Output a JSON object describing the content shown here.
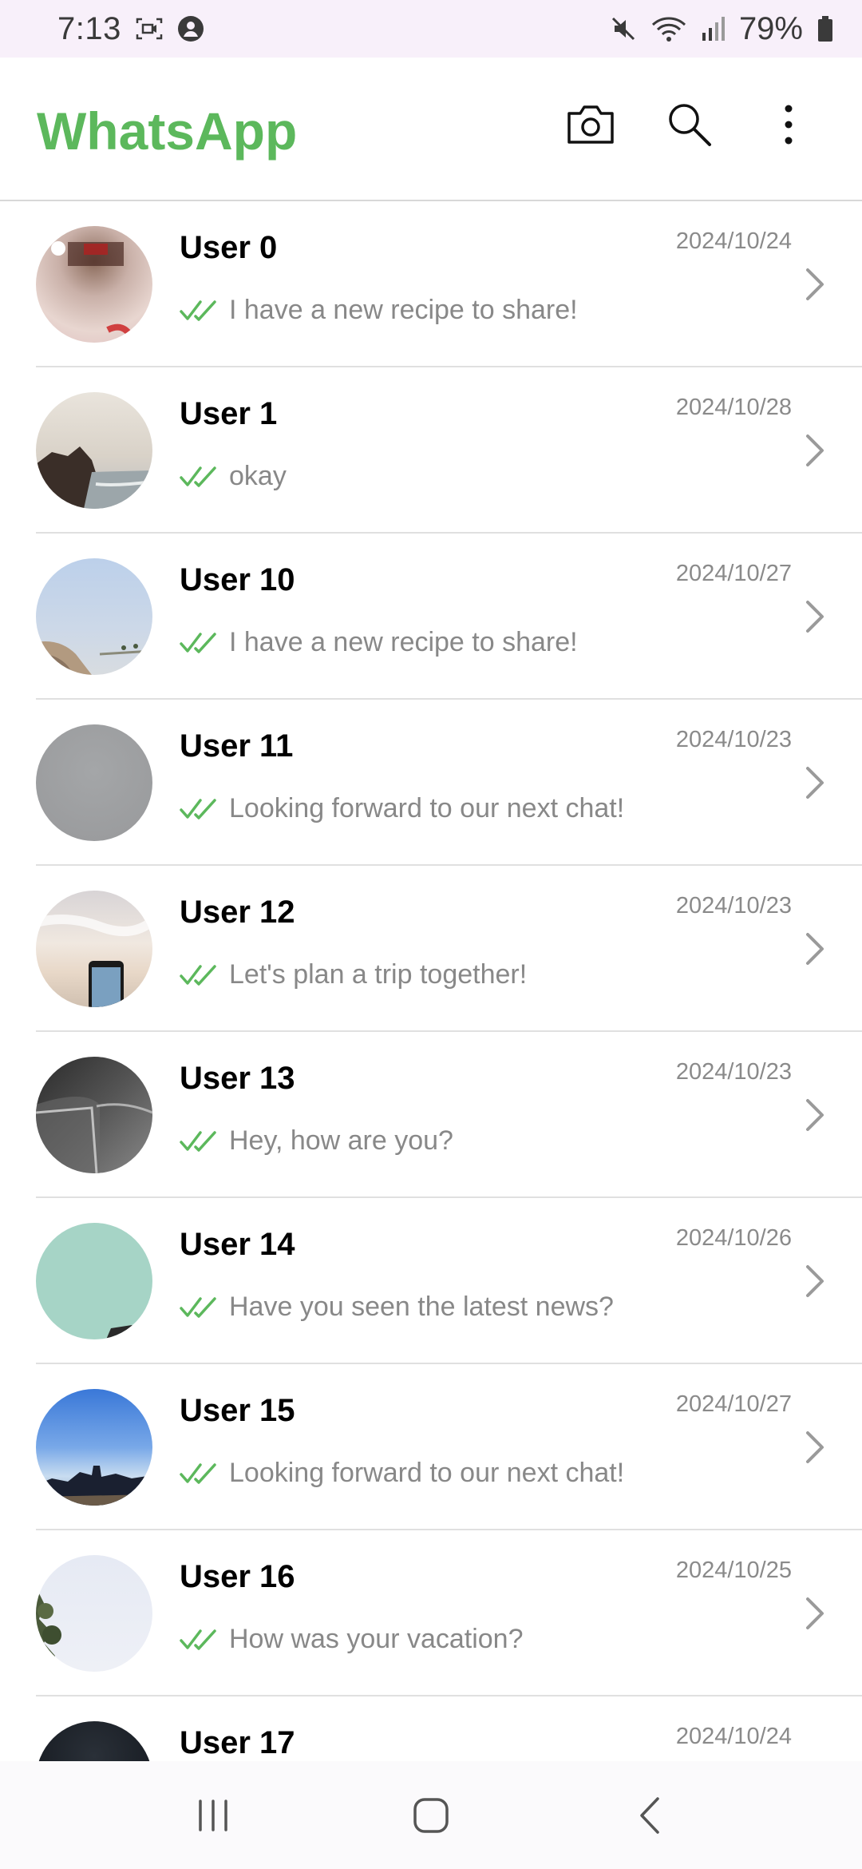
{
  "status_bar": {
    "time": "7:13",
    "battery": "79%"
  },
  "app": {
    "title": "WhatsApp",
    "accent_color": "#5cb85c"
  },
  "actions": {
    "camera_icon": "camera-icon",
    "search_icon": "search-icon",
    "menu_icon": "more-vert-icon"
  },
  "chats": [
    {
      "name": "User 0",
      "date": "2024/10/24",
      "message": "I have a new recipe to share!"
    },
    {
      "name": "User 1",
      "date": "2024/10/28",
      "message": "okay"
    },
    {
      "name": "User 10",
      "date": "2024/10/27",
      "message": "I have a new recipe to share!"
    },
    {
      "name": "User 11",
      "date": "2024/10/23",
      "message": "Looking forward to our next chat!"
    },
    {
      "name": "User 12",
      "date": "2024/10/23",
      "message": "Let's plan a trip together!"
    },
    {
      "name": "User 13",
      "date": "2024/10/23",
      "message": "Hey, how are you?"
    },
    {
      "name": "User 14",
      "date": "2024/10/26",
      "message": "Have you seen the latest news?"
    },
    {
      "name": "User 15",
      "date": "2024/10/27",
      "message": "Looking forward to our next chat!"
    },
    {
      "name": "User 16",
      "date": "2024/10/25",
      "message": "How was your vacation?"
    },
    {
      "name": "User 17",
      "date": "2024/10/24",
      "message": ""
    }
  ],
  "nav": {
    "recents_icon": "recents-icon",
    "home_icon": "home-icon",
    "back_icon": "back-icon"
  }
}
